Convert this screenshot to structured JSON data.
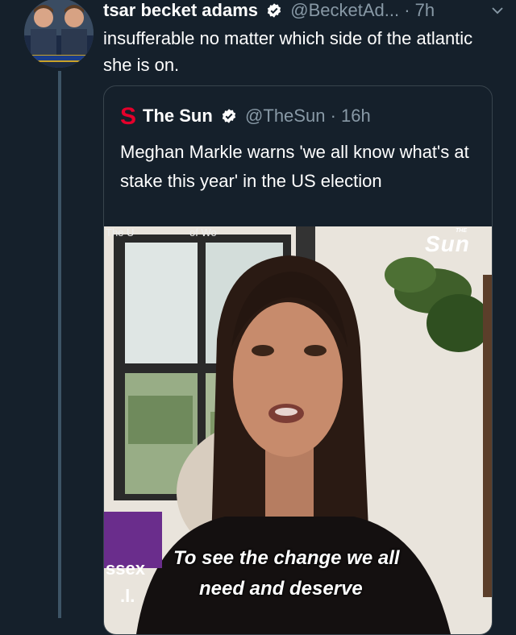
{
  "tweet": {
    "display_name": "tsar becket adams",
    "handle": "@BecketAd...",
    "time": "· 7h",
    "text": "insufferable no matter which side of the atlantic she is on."
  },
  "quoted": {
    "display_name": "The Sun",
    "handle": "@TheSun",
    "time": "· 16h",
    "text": "Meghan Markle warns 'we all know what's at stake this year' in the US election",
    "logo_letter": "S"
  },
  "video": {
    "subtitle_line1": "To see the change we all",
    "subtitle_line2": "need and deserve",
    "corner_text_top": "The U",
    "corner_text_mid": "of Wo",
    "brand_small": "THE",
    "brand": "Sun",
    "side_label": "ssex",
    "side_mark": ".l."
  },
  "colors": {
    "background": "#15202b",
    "sun_red": "#e4002b",
    "verified": "#ffffff"
  }
}
